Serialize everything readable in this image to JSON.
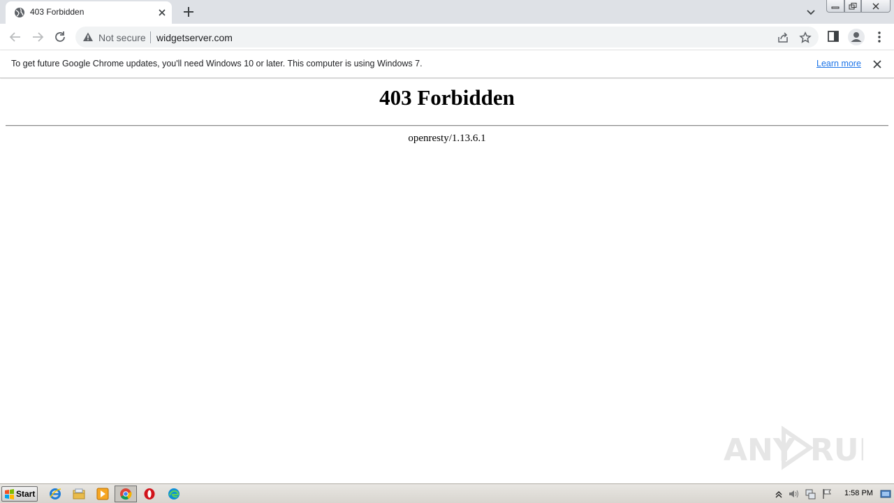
{
  "tab": {
    "title": "403 Forbidden",
    "favicon": "globe-icon"
  },
  "omnibox": {
    "security_label": "Not secure",
    "url": "widgetserver.com"
  },
  "infobar": {
    "message": "To get future Google Chrome updates, you'll need Windows 10 or later. This computer is using Windows 7.",
    "link": "Learn more"
  },
  "page": {
    "heading": "403 Forbidden",
    "server": "openresty/1.13.6.1"
  },
  "watermark": {
    "text": "ANY RUN"
  },
  "taskbar": {
    "start_label": "Start",
    "pinned": [
      "internet-explorer-icon",
      "folder-icon",
      "media-player-icon",
      "chrome-icon",
      "opera-icon",
      "edge-icon"
    ],
    "clock": "1:58 PM"
  },
  "colors": {
    "link": "#1a73e8",
    "tabstrip": "#dee1e6",
    "omnibox": "#f1f3f4"
  }
}
